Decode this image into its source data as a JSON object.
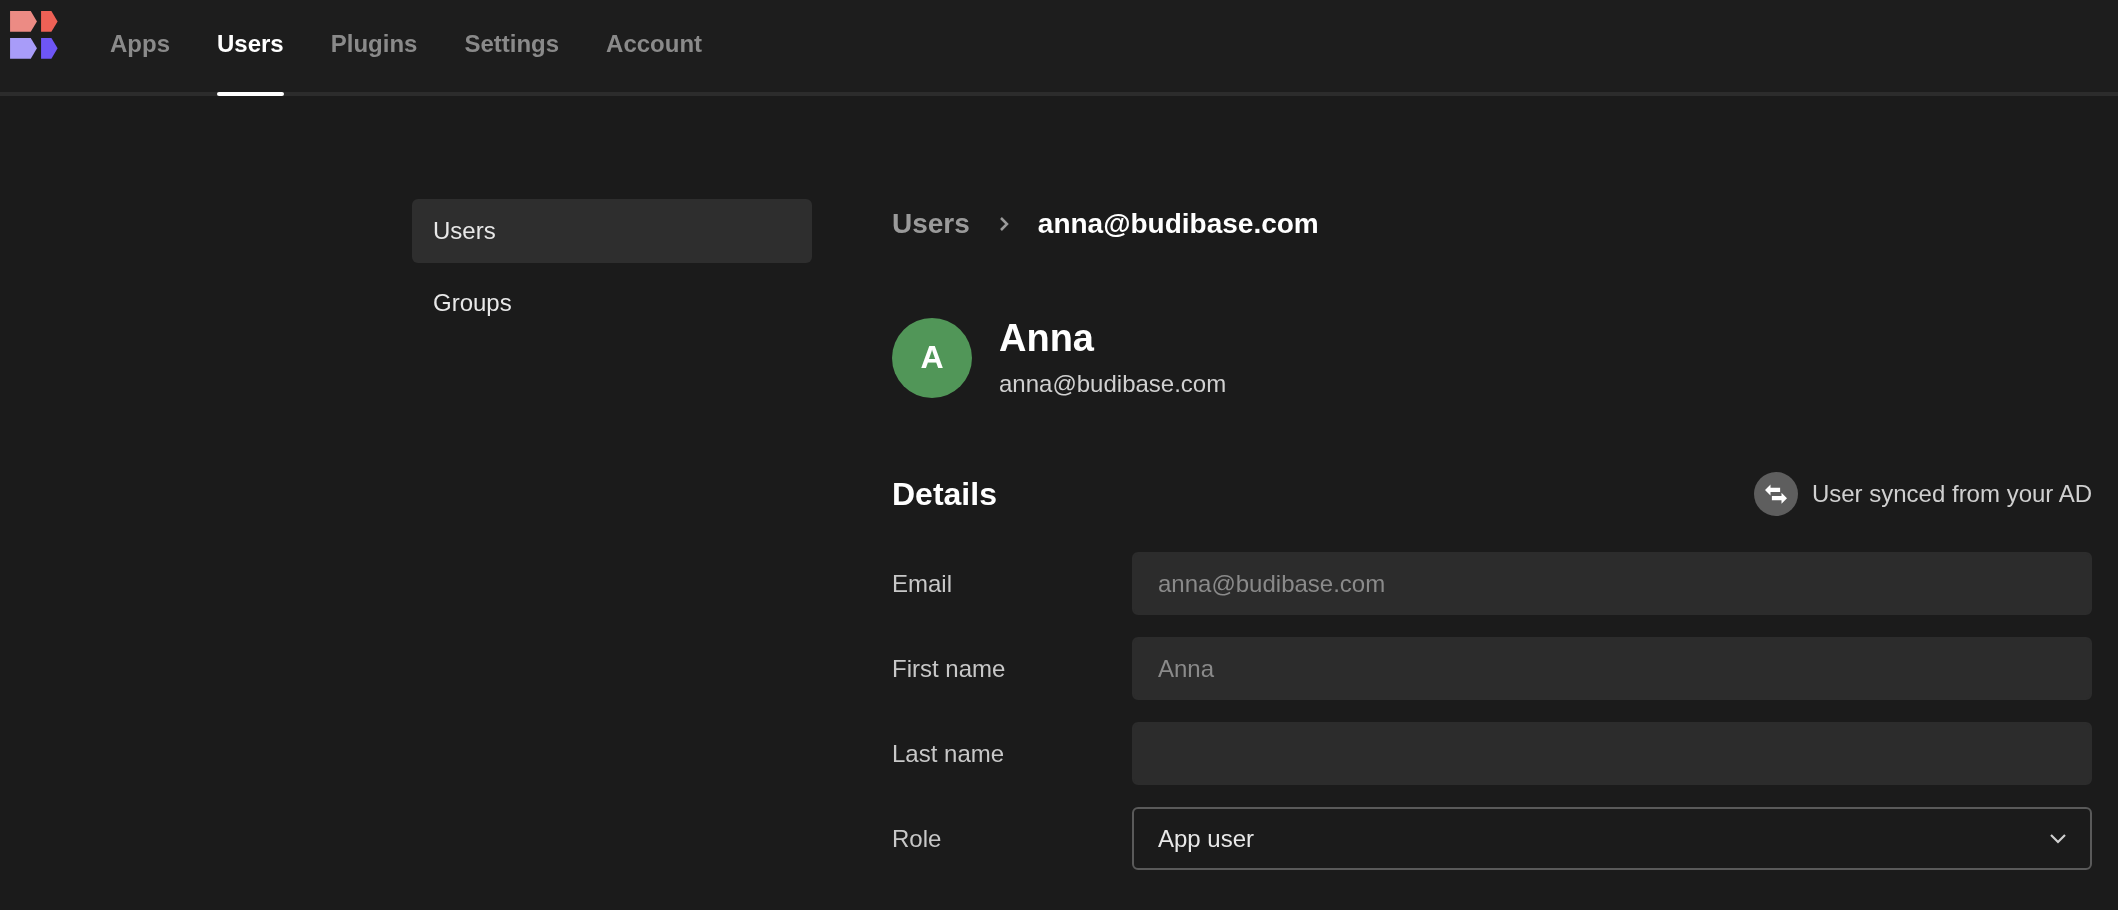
{
  "nav": {
    "tabs": [
      {
        "label": "Apps",
        "selected": false
      },
      {
        "label": "Users",
        "selected": true
      },
      {
        "label": "Plugins",
        "selected": false
      },
      {
        "label": "Settings",
        "selected": false
      },
      {
        "label": "Account",
        "selected": false
      }
    ]
  },
  "sidebar": {
    "items": [
      {
        "label": "Users",
        "selected": true
      },
      {
        "label": "Groups",
        "selected": false
      }
    ]
  },
  "breadcrumb": {
    "parent": "Users",
    "current": "anna@budibase.com"
  },
  "profile": {
    "initial": "A",
    "name": "Anna",
    "email": "anna@budibase.com"
  },
  "details": {
    "title": "Details",
    "sync_note": "User synced from your AD",
    "fields": [
      {
        "label": "Email",
        "kind": "text",
        "value": "anna@budibase.com",
        "disabled": true
      },
      {
        "label": "First name",
        "kind": "text",
        "value": "Anna",
        "disabled": true
      },
      {
        "label": "Last name",
        "kind": "text",
        "disabled": true
      },
      {
        "label": "Role",
        "kind": "select",
        "value": "App user",
        "disabled": false
      }
    ]
  }
}
